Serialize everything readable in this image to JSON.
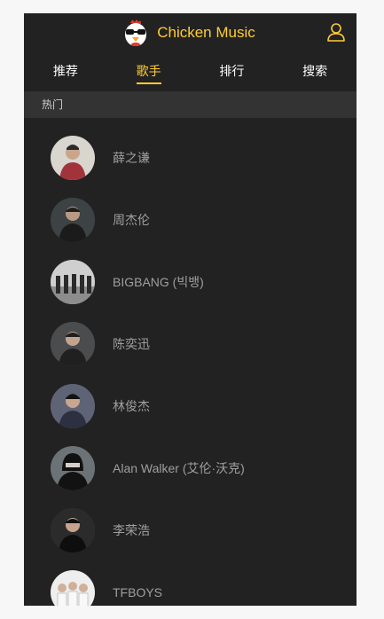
{
  "header": {
    "title": "Chicken Music",
    "logo_icon": "chicken-logo-icon",
    "user_icon": "user-icon",
    "accent": "#ffcd32"
  },
  "tabs": [
    {
      "label": "推荐",
      "active": false
    },
    {
      "label": "歌手",
      "active": true
    },
    {
      "label": "排行",
      "active": false
    },
    {
      "label": "搜索",
      "active": false
    }
  ],
  "section": {
    "title": "热门"
  },
  "singers": [
    {
      "name": "薛之谦"
    },
    {
      "name": "周杰伦"
    },
    {
      "name": "BIGBANG (빅뱅)"
    },
    {
      "name": "陈奕迅"
    },
    {
      "name": "林俊杰"
    },
    {
      "name": "Alan Walker (艾伦·沃克)"
    },
    {
      "name": "李荣浩"
    },
    {
      "name": "TFBOYS"
    }
  ]
}
